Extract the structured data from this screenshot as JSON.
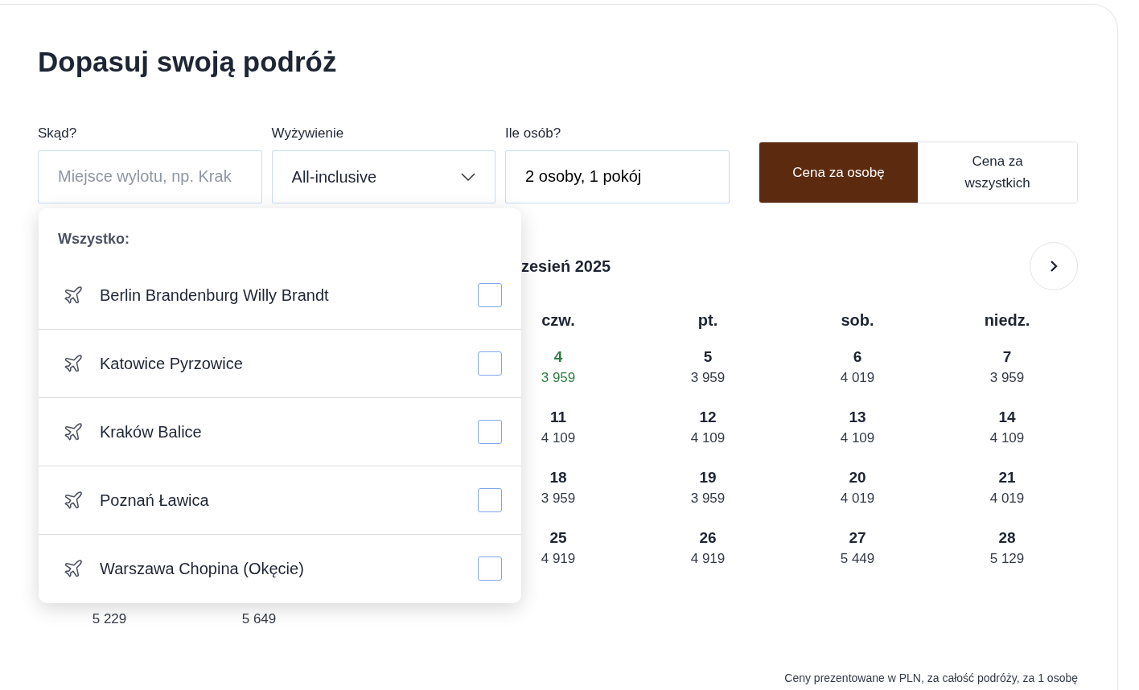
{
  "title": "Dopasuj swoją podróż",
  "fields": [
    {
      "kind": "input",
      "label": "Skąd?",
      "placeholder": "Miejsce wylotu, np. Krak"
    },
    {
      "kind": "select",
      "label": "Wyżywienie",
      "value": "All-inclusive"
    },
    {
      "kind": "input",
      "label": "Ile osób?",
      "value": "2 osoby, 1 pokój"
    }
  ],
  "price_toggle": [
    {
      "label": "Cena za osobę",
      "selected": true
    },
    {
      "label": "Cena za wszystkich",
      "selected": false
    }
  ],
  "departure_dropdown": {
    "heading": "Wszystko:",
    "items": [
      {
        "label": "Berlin Brandenburg Willy Brandt",
        "checked": false
      },
      {
        "label": "Katowice Pyrzowice",
        "checked": false
      },
      {
        "label": "Kraków Balice",
        "checked": false
      },
      {
        "label": "Poznań Ławica",
        "checked": false
      },
      {
        "label": "Warszawa Chopina (Okęcie)",
        "checked": false
      }
    ]
  },
  "calendar": {
    "month_title": "zesień 2025",
    "right_columns": [
      {
        "weekday": "czw.",
        "days": [
          {
            "date": "4",
            "price": "3 959",
            "lowest": true
          },
          {
            "date": "11",
            "price": "4 109",
            "lowest": false
          },
          {
            "date": "18",
            "price": "3 959",
            "lowest": false
          },
          {
            "date": "25",
            "price": "4 919",
            "lowest": false
          }
        ]
      },
      {
        "weekday": "pt.",
        "days": [
          {
            "date": "5",
            "price": "3 959",
            "lowest": false
          },
          {
            "date": "12",
            "price": "4 109",
            "lowest": false
          },
          {
            "date": "19",
            "price": "3 959",
            "lowest": false
          },
          {
            "date": "26",
            "price": "4 919",
            "lowest": false
          }
        ]
      },
      {
        "weekday": "sob.",
        "days": [
          {
            "date": "6",
            "price": "4 019",
            "lowest": false
          },
          {
            "date": "13",
            "price": "4 109",
            "lowest": false
          },
          {
            "date": "20",
            "price": "4 019",
            "lowest": false
          },
          {
            "date": "27",
            "price": "5 449",
            "lowest": false
          }
        ]
      },
      {
        "weekday": "niedz.",
        "days": [
          {
            "date": "7",
            "price": "3 959",
            "lowest": false
          },
          {
            "date": "14",
            "price": "4 109",
            "lowest": false
          },
          {
            "date": "21",
            "price": "4 019",
            "lowest": false
          },
          {
            "date": "28",
            "price": "5 129",
            "lowest": false
          }
        ]
      }
    ],
    "last_week_prices": [
      {
        "price": "5 229",
        "lowest": false
      },
      {
        "price": "5 649",
        "lowest": false
      }
    ]
  },
  "footnote": "Ceny prezentowane w PLN, za całość podróży, za 1 osobę"
}
